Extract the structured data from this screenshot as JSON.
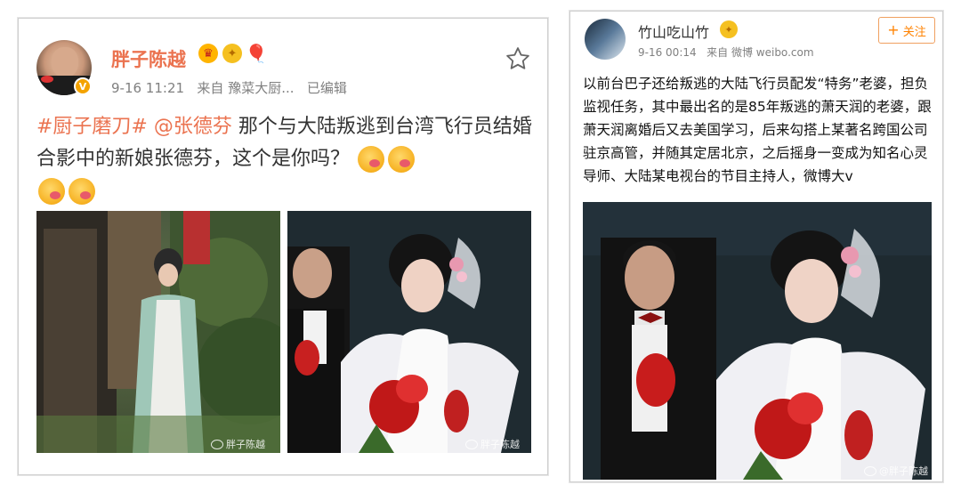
{
  "left_post": {
    "username": "胖子陈越",
    "verified_badge": "V",
    "badges": [
      "crown-icon",
      "medal-icon",
      "balloon-icon"
    ],
    "time": "9-16 11:21",
    "source_prefix": "来自",
    "source": "豫菜大厨...",
    "edited": "已编辑",
    "hashtag": "#厨子磨刀#",
    "mention": "@张德芬",
    "text": " 那个与大陆叛逃到台湾飞行员结婚合影中的新娘张德芬，这个是你吗？",
    "emoji_count": 4,
    "watermark_1": "胖子陈越",
    "watermark_2": "胖子陈越"
  },
  "right_post": {
    "username": "竹山吃山竹",
    "time": "9-16 00:14",
    "source_prefix": "来自",
    "source": "微博 weibo.com",
    "follow_label": "关注",
    "text": "以前台巴子还给叛逃的大陆飞行员配发“特务”老婆，担负监视任务，其中最出名的是85年叛逃的萧天润的老婆，跟萧天润离婚后又去美国学习，后来勾搭上某著名跨国公司驻京高管，并随其定居北京，之后摇身一变成为知名心灵导师、大陆某电视台的节目主持人，微博大v",
    "watermark": "@胖子陈越"
  },
  "colors": {
    "accent": "#eb7350",
    "follow": "#ff8200",
    "meta": "#808080"
  }
}
